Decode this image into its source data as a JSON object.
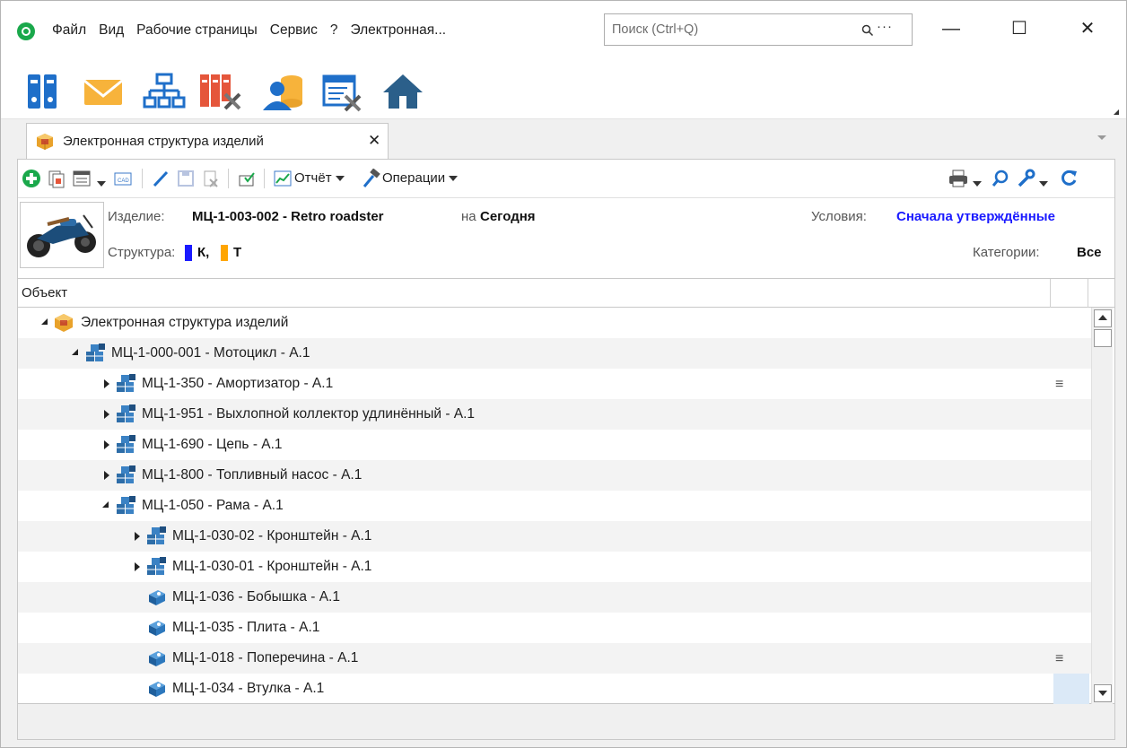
{
  "menu": {
    "items": [
      "Файл",
      "Вид",
      "Рабочие страницы",
      "Сервис",
      "?",
      "Электронная..."
    ],
    "search_placeholder": "Поиск (Ctrl+Q)",
    "search_more": "···"
  },
  "window_controls": {
    "minimize": "—",
    "maximize": "☐",
    "close": "✕"
  },
  "big_toolbar": {
    "icons": [
      "binders-icon",
      "mail-icon",
      "org-structure-icon",
      "archive-tools-icon",
      "user-database-icon",
      "document-settings-icon",
      "home-icon"
    ]
  },
  "tab": {
    "label": "Электронная структура изделий",
    "close": "✕"
  },
  "commands": {
    "report_label": "Отчёт",
    "operations_label": "Операции"
  },
  "info": {
    "product_label": "Изделие:",
    "product_value": "МЦ-1-003-002 - Retro roadster",
    "on_label": "на",
    "date_value": "Сегодня",
    "structure_label": "Структура:",
    "structure_k": "К,",
    "structure_t": "Т",
    "conditions_label": "Условия:",
    "conditions_value": "Сначала утверждённые",
    "categories_label": "Категории:",
    "categories_value": "Все",
    "colors": {
      "k": "#1a1aff",
      "t": "#ffa500",
      "link": "#1a1aff"
    }
  },
  "grid": {
    "column_header": "Объект",
    "rows": [
      {
        "text": "Электронная структура изделий",
        "icon": "folder-icon"
      },
      {
        "text": "МЦ-1-000-001 - Мотоцикл - А.1",
        "icon": "assembly-icon"
      },
      {
        "text": "МЦ-1-350  - Амортизатор - А.1",
        "icon": "assembly-icon"
      },
      {
        "text": "МЦ-1-951 - Выхлопной коллектор удлинённый - А.1",
        "icon": "assembly-icon"
      },
      {
        "text": "МЦ-1-690 - Цепь - А.1",
        "icon": "assembly-icon"
      },
      {
        "text": "МЦ-1-800 - Топливный насос - А.1",
        "icon": "assembly-icon"
      },
      {
        "text": "МЦ-1-050 - Рама - А.1",
        "icon": "assembly-icon"
      },
      {
        "text": "МЦ-1-030-02 - Кронштейн - А.1",
        "icon": "assembly-icon"
      },
      {
        "text": "МЦ-1-030-01 - Кронштейн - А.1",
        "icon": "assembly-icon"
      },
      {
        "text": "МЦ-1-036 - Бобышка - А.1",
        "icon": "part-icon"
      },
      {
        "text": "МЦ-1-035 - Плита - А.1",
        "icon": "part-icon"
      },
      {
        "text": "МЦ-1-018 - Поперечина - А.1",
        "icon": "part-icon"
      },
      {
        "text": "МЦ-1-034 - Втулка - А.1",
        "icon": "part-icon"
      }
    ],
    "row_menu": "≡"
  }
}
